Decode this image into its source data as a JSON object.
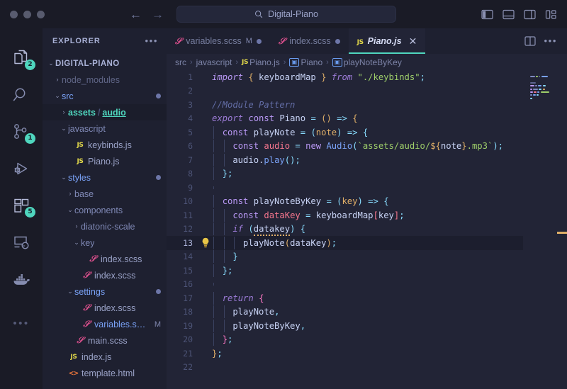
{
  "window": {
    "traffic_lights": [
      "close",
      "minimize",
      "maximize"
    ],
    "nav_back": "←",
    "nav_forward": "→",
    "search": {
      "value": "Digital-Piano",
      "icon": "search-icon"
    },
    "layout_toggles": [
      "toggle-primary-sidebar",
      "toggle-panel",
      "toggle-secondary-sidebar",
      "customize-layout"
    ]
  },
  "activitybar": {
    "items": [
      {
        "name": "explorer",
        "icon": "files-icon",
        "badge": "2",
        "active": true
      },
      {
        "name": "search",
        "icon": "search-icon",
        "badge": ""
      },
      {
        "name": "source-control",
        "icon": "source-control-icon",
        "badge": "1"
      },
      {
        "name": "run-and-debug",
        "icon": "run-debug-icon",
        "badge": ""
      },
      {
        "name": "extensions",
        "icon": "extensions-icon",
        "badge": "5"
      },
      {
        "name": "remote-explorer",
        "icon": "remote-explorer-icon",
        "badge": ""
      },
      {
        "name": "docker",
        "icon": "docker-whale-icon",
        "badge": ""
      },
      {
        "name": "additional-views",
        "icon": "ellipsis-icon",
        "badge": ""
      }
    ],
    "more_label": "•••"
  },
  "sidebar": {
    "title": "EXPLORER",
    "more_label": "•••",
    "tree": [
      {
        "depth": 0,
        "chev": "⌄",
        "kind": "root",
        "label": "DIGITAL-PIANO",
        "mark": "",
        "dot": false,
        "selected": false
      },
      {
        "depth": 1,
        "chev": "›",
        "kind": "dim",
        "label": "node_modules",
        "mark": "",
        "dot": false,
        "selected": false
      },
      {
        "depth": 1,
        "chev": "⌄",
        "kind": "blue",
        "label": "src",
        "mark": "",
        "dot": true,
        "selected": false
      },
      {
        "depth": 2,
        "chev": "›",
        "kind": "compact",
        "label": "assets",
        "label2": "audio",
        "mark": "",
        "dot": false,
        "selected": true
      },
      {
        "depth": 2,
        "chev": "⌄",
        "kind": "folder",
        "label": "javascript",
        "mark": "",
        "dot": false,
        "selected": false
      },
      {
        "depth": 3,
        "chev": "",
        "kind": "js",
        "label": "keybinds.js",
        "mark": "",
        "dot": false,
        "selected": false
      },
      {
        "depth": 3,
        "chev": "",
        "kind": "js",
        "label": "Piano.js",
        "mark": "",
        "dot": false,
        "selected": false
      },
      {
        "depth": 2,
        "chev": "⌄",
        "kind": "blue",
        "label": "styles",
        "mark": "",
        "dot": true,
        "selected": false
      },
      {
        "depth": 3,
        "chev": "›",
        "kind": "folder",
        "label": "base",
        "mark": "",
        "dot": false,
        "selected": false
      },
      {
        "depth": 3,
        "chev": "⌄",
        "kind": "folder",
        "label": "components",
        "mark": "",
        "dot": false,
        "selected": false
      },
      {
        "depth": 4,
        "chev": "›",
        "kind": "folder",
        "label": "diatonic-scale",
        "mark": "",
        "dot": false,
        "selected": false
      },
      {
        "depth": 4,
        "chev": "⌄",
        "kind": "folder",
        "label": "key",
        "mark": "",
        "dot": false,
        "selected": false
      },
      {
        "depth": 5,
        "chev": "",
        "kind": "scss",
        "label": "index.scss",
        "mark": "",
        "dot": false,
        "selected": false
      },
      {
        "depth": 4,
        "chev": "",
        "kind": "scss",
        "label": "index.scss",
        "mark": "",
        "dot": false,
        "selected": false
      },
      {
        "depth": 3,
        "chev": "⌄",
        "kind": "blue",
        "label": "settings",
        "mark": "",
        "dot": true,
        "selected": false
      },
      {
        "depth": 4,
        "chev": "",
        "kind": "scss",
        "label": "index.scss",
        "mark": "",
        "dot": false,
        "selected": false
      },
      {
        "depth": 4,
        "chev": "",
        "kind": "scss-mod",
        "label": "variables.s…",
        "mark": "M",
        "dot": false,
        "selected": false
      },
      {
        "depth": 3,
        "chev": "",
        "kind": "scss",
        "label": "main.scss",
        "mark": "",
        "dot": false,
        "selected": false
      },
      {
        "depth": 2,
        "chev": "",
        "kind": "js",
        "label": "index.js",
        "mark": "",
        "dot": false,
        "selected": false
      },
      {
        "depth": 2,
        "chev": "",
        "kind": "html",
        "label": "template.html",
        "mark": "",
        "dot": false,
        "selected": false
      }
    ]
  },
  "editor": {
    "tabs": [
      {
        "name": "variables.scss",
        "icon": "scss-icon",
        "modified_mark": "M",
        "dirty": true,
        "active": false
      },
      {
        "name": "index.scss",
        "icon": "scss-icon",
        "modified_mark": "",
        "dirty": true,
        "active": false
      },
      {
        "name": "Piano.js",
        "icon": "js-icon",
        "modified_mark": "",
        "dirty": false,
        "active": true,
        "close_label": "✕"
      }
    ],
    "tab_actions": {
      "split_editor": "split-editor-icon",
      "more": "•••"
    },
    "breadcrumb": [
      {
        "label": "src",
        "icon": ""
      },
      {
        "label": "javascript",
        "icon": ""
      },
      {
        "label": "Piano.js",
        "icon": "js"
      },
      {
        "label": "Piano",
        "icon": "sym"
      },
      {
        "label": "playNoteByKey",
        "icon": "sym"
      }
    ],
    "breadcrumb_separator": "›",
    "active_line": 13,
    "lightbulb": "💡",
    "lines": [
      {
        "n": "1",
        "indents": 0,
        "tokens": [
          {
            "t": "import",
            "c": "k-imp"
          },
          {
            "t": " ",
            "c": "k-white"
          },
          {
            "t": "{",
            "c": "k-brace"
          },
          {
            "t": " keyboardMap ",
            "c": "k-white"
          },
          {
            "t": "}",
            "c": "k-brace"
          },
          {
            "t": " ",
            "c": "k-white"
          },
          {
            "t": "from",
            "c": "k-kw2"
          },
          {
            "t": " ",
            "c": "k-white"
          },
          {
            "t": "\"./keybinds\"",
            "c": "k-str"
          },
          {
            "t": ";",
            "c": "k-punc"
          }
        ]
      },
      {
        "n": "2",
        "indents": 0,
        "tokens": []
      },
      {
        "n": "3",
        "indents": 0,
        "tokens": [
          {
            "t": "//Module Pattern",
            "c": "k-cmt"
          }
        ]
      },
      {
        "n": "4",
        "indents": 0,
        "tokens": [
          {
            "t": "export",
            "c": "k-kw2"
          },
          {
            "t": " ",
            "c": "k-white"
          },
          {
            "t": "const",
            "c": "k-kw"
          },
          {
            "t": " Piano ",
            "c": "k-white"
          },
          {
            "t": "=",
            "c": "k-op"
          },
          {
            "t": " ",
            "c": "k-white"
          },
          {
            "t": "(",
            "c": "k-brace"
          },
          {
            "t": ")",
            "c": "k-brace"
          },
          {
            "t": " ",
            "c": "k-white"
          },
          {
            "t": "=>",
            "c": "k-op"
          },
          {
            "t": " ",
            "c": "k-white"
          },
          {
            "t": "{",
            "c": "k-brace"
          }
        ]
      },
      {
        "n": "5",
        "indents": 1,
        "tokens": [
          {
            "t": "  ",
            "c": "k-white"
          },
          {
            "t": "const",
            "c": "k-kw"
          },
          {
            "t": " playNote ",
            "c": "k-white"
          },
          {
            "t": "=",
            "c": "k-op"
          },
          {
            "t": " ",
            "c": "k-white"
          },
          {
            "t": "(",
            "c": "k-punc"
          },
          {
            "t": "note",
            "c": "k-param"
          },
          {
            "t": ")",
            "c": "k-punc"
          },
          {
            "t": " ",
            "c": "k-white"
          },
          {
            "t": "=>",
            "c": "k-op"
          },
          {
            "t": " ",
            "c": "k-white"
          },
          {
            "t": "{",
            "c": "k-punc"
          }
        ]
      },
      {
        "n": "6",
        "indents": 2,
        "tokens": [
          {
            "t": "    ",
            "c": "k-white"
          },
          {
            "t": "const",
            "c": "k-kw"
          },
          {
            "t": " ",
            "c": "k-white"
          },
          {
            "t": "audio",
            "c": "k-red"
          },
          {
            "t": " ",
            "c": "k-white"
          },
          {
            "t": "=",
            "c": "k-op"
          },
          {
            "t": " ",
            "c": "k-white"
          },
          {
            "t": "new",
            "c": "k-kw"
          },
          {
            "t": " ",
            "c": "k-white"
          },
          {
            "t": "Audio",
            "c": "k-fn"
          },
          {
            "t": "(",
            "c": "k-punc"
          },
          {
            "t": "`assets/audio/",
            "c": "k-str"
          },
          {
            "t": "${",
            "c": "k-brace"
          },
          {
            "t": "note",
            "c": "k-white"
          },
          {
            "t": "}",
            "c": "k-brace"
          },
          {
            "t": ".mp3`",
            "c": "k-str"
          },
          {
            "t": ")",
            "c": "k-punc"
          },
          {
            "t": ";",
            "c": "k-punc"
          }
        ]
      },
      {
        "n": "7",
        "indents": 2,
        "tokens": [
          {
            "t": "    audio",
            "c": "k-white"
          },
          {
            "t": ".",
            "c": "k-white"
          },
          {
            "t": "play",
            "c": "k-fn"
          },
          {
            "t": "(",
            "c": "k-punc"
          },
          {
            "t": ")",
            "c": "k-punc"
          },
          {
            "t": ";",
            "c": "k-punc"
          }
        ]
      },
      {
        "n": "8",
        "indents": 1,
        "tokens": [
          {
            "t": "  ",
            "c": "k-white"
          },
          {
            "t": "}",
            "c": "k-punc"
          },
          {
            "t": ";",
            "c": "k-punc"
          }
        ]
      },
      {
        "n": "9",
        "indents": 1,
        "tokens": []
      },
      {
        "n": "10",
        "indents": 1,
        "tokens": [
          {
            "t": "  ",
            "c": "k-white"
          },
          {
            "t": "const",
            "c": "k-kw"
          },
          {
            "t": " playNoteByKey ",
            "c": "k-white"
          },
          {
            "t": "=",
            "c": "k-op"
          },
          {
            "t": " ",
            "c": "k-white"
          },
          {
            "t": "(",
            "c": "k-punc"
          },
          {
            "t": "key",
            "c": "k-param"
          },
          {
            "t": ")",
            "c": "k-punc"
          },
          {
            "t": " ",
            "c": "k-white"
          },
          {
            "t": "=>",
            "c": "k-op"
          },
          {
            "t": " ",
            "c": "k-white"
          },
          {
            "t": "{",
            "c": "k-punc"
          }
        ]
      },
      {
        "n": "11",
        "indents": 2,
        "tokens": [
          {
            "t": "    ",
            "c": "k-white"
          },
          {
            "t": "const",
            "c": "k-kw"
          },
          {
            "t": " ",
            "c": "k-white"
          },
          {
            "t": "dataKey",
            "c": "k-red"
          },
          {
            "t": " ",
            "c": "k-white"
          },
          {
            "t": "=",
            "c": "k-op"
          },
          {
            "t": " keyboardMap",
            "c": "k-white"
          },
          {
            "t": "[",
            "c": "k-red"
          },
          {
            "t": "key",
            "c": "k-white"
          },
          {
            "t": "]",
            "c": "k-red"
          },
          {
            "t": ";",
            "c": "k-punc"
          }
        ]
      },
      {
        "n": "12",
        "indents": 2,
        "tokens": [
          {
            "t": "    ",
            "c": "k-white"
          },
          {
            "t": "if",
            "c": "k-kw2"
          },
          {
            "t": " ",
            "c": "k-white"
          },
          {
            "t": "(",
            "c": "k-punc"
          },
          {
            "t": "datakey",
            "c": "k-white squig"
          },
          {
            "t": ")",
            "c": "k-punc"
          },
          {
            "t": " ",
            "c": "k-white"
          },
          {
            "t": "{",
            "c": "k-punc"
          }
        ]
      },
      {
        "n": "13",
        "indents": 3,
        "tokens": [
          {
            "t": "      ",
            "c": "k-white"
          },
          {
            "t": "playNote",
            "c": "k-white"
          },
          {
            "t": "(",
            "c": "k-brace"
          },
          {
            "t": "dataKey",
            "c": "k-white"
          },
          {
            "t": ")",
            "c": "k-brace"
          },
          {
            "t": ";",
            "c": "k-punc"
          }
        ]
      },
      {
        "n": "14",
        "indents": 2,
        "tokens": [
          {
            "t": "    ",
            "c": "k-white"
          },
          {
            "t": "}",
            "c": "k-punc"
          }
        ]
      },
      {
        "n": "15",
        "indents": 1,
        "tokens": [
          {
            "t": "  ",
            "c": "k-white"
          },
          {
            "t": "}",
            "c": "k-punc"
          },
          {
            "t": ";",
            "c": "k-punc"
          }
        ]
      },
      {
        "n": "16",
        "indents": 1,
        "tokens": []
      },
      {
        "n": "17",
        "indents": 1,
        "tokens": [
          {
            "t": "  ",
            "c": "k-white"
          },
          {
            "t": "return",
            "c": "k-kw2"
          },
          {
            "t": " ",
            "c": "k-white"
          },
          {
            "t": "{",
            "c": "k-magenta"
          }
        ]
      },
      {
        "n": "18",
        "indents": 2,
        "tokens": [
          {
            "t": "    playNote",
            "c": "k-white"
          },
          {
            "t": ",",
            "c": "k-punc"
          }
        ]
      },
      {
        "n": "19",
        "indents": 2,
        "tokens": [
          {
            "t": "    playNoteByKey",
            "c": "k-white"
          },
          {
            "t": ",",
            "c": "k-punc"
          }
        ]
      },
      {
        "n": "20",
        "indents": 1,
        "tokens": [
          {
            "t": "  ",
            "c": "k-white"
          },
          {
            "t": "}",
            "c": "k-magenta"
          },
          {
            "t": ";",
            "c": "k-punc"
          }
        ]
      },
      {
        "n": "21",
        "indents": 0,
        "tokens": [
          {
            "t": "}",
            "c": "k-brace"
          },
          {
            "t": ";",
            "c": "k-punc"
          }
        ]
      },
      {
        "n": "22",
        "indents": 0,
        "tokens": []
      }
    ]
  },
  "minimap": {
    "scrollbar_color": "#e0af68",
    "rows": [
      [
        [
          7,
          "#7e8ac0"
        ],
        [
          3,
          "#9ece6a"
        ],
        [
          2,
          "#6a7199"
        ],
        [
          9,
          "#7aa2f7"
        ]
      ],
      [],
      [
        [
          8,
          "#5d6590"
        ]
      ],
      [
        [
          6,
          "#bb9af7"
        ],
        [
          3,
          "#7e8ac0"
        ],
        [
          5,
          "#7aa2f7"
        ],
        [
          4,
          "#89ddff"
        ]
      ],
      [
        [
          3,
          "#bb9af7"
        ],
        [
          7,
          "#7e8ac0"
        ],
        [
          4,
          "#89ddff"
        ],
        [
          3,
          "#e0af68"
        ]
      ],
      [
        [
          4,
          "#bb9af7"
        ],
        [
          4,
          "#f7768e"
        ],
        [
          3,
          "#7aa2f7"
        ],
        [
          12,
          "#9ece6a"
        ]
      ],
      [
        [
          3,
          "#7e8ac0"
        ],
        [
          4,
          "#7aa2f7"
        ],
        [
          3,
          "#89ddff"
        ]
      ],
      [
        [
          3,
          "#89ddff"
        ]
      ]
    ]
  },
  "colors": {
    "accent_teal": "#4fd6be",
    "bg_titlebar": "#1a1b26",
    "bg_sidebar": "#1e2030",
    "bg_editor": "#222436",
    "badge": "#4fd6be"
  }
}
